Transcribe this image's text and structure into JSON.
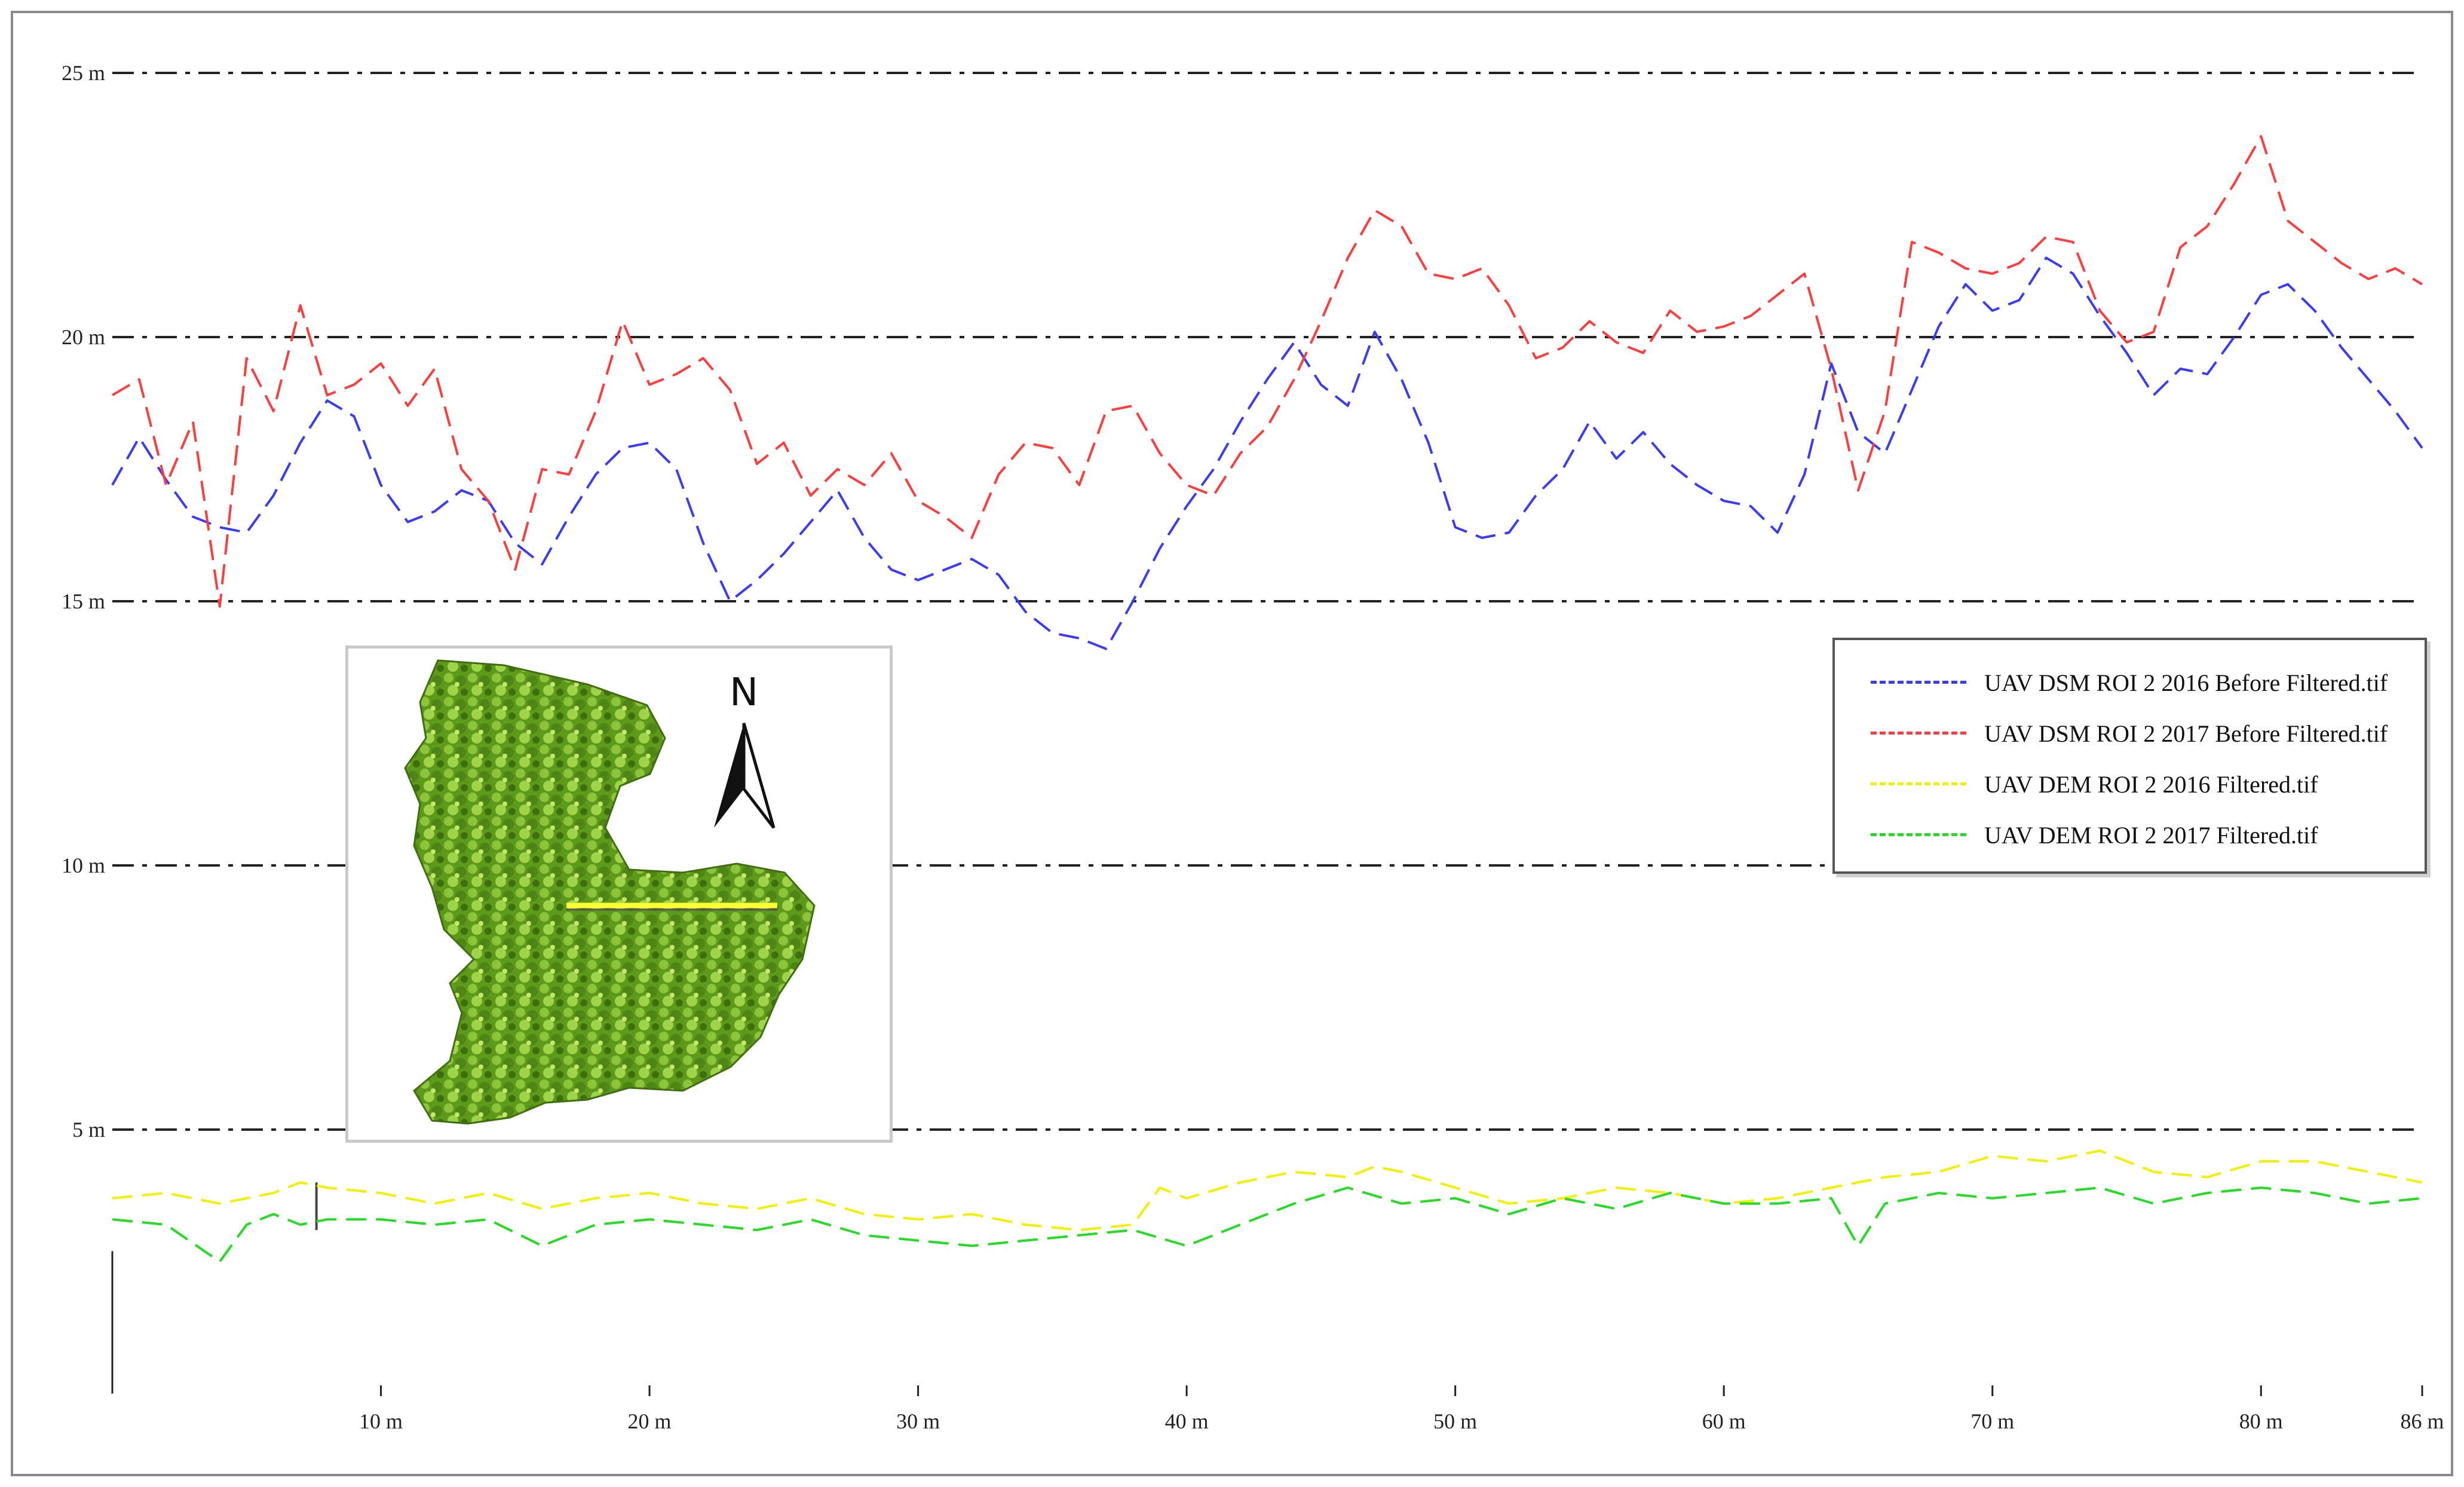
{
  "chart_data": {
    "type": "line",
    "title": "",
    "xlabel": "",
    "ylabel": "",
    "xlim": [
      0,
      86
    ],
    "ylim": [
      0,
      25
    ],
    "x_ticks": [
      "10 m",
      "20 m",
      "30 m",
      "40 m",
      "50 m",
      "60 m",
      "70 m",
      "80 m",
      "86 m"
    ],
    "y_ticks": [
      "5 m",
      "10 m",
      "15 m",
      "20 m",
      "25 m"
    ],
    "grid": "horizontal dash-dot",
    "legend_position": "right-middle",
    "series": [
      {
        "name": "UAV DSM ROI 2 2016 Before Filtered.tif",
        "color": "#3a3aff",
        "style": "dashed",
        "x": [
          0,
          1,
          2,
          3,
          4,
          5,
          6,
          7,
          8,
          9,
          10,
          11,
          12,
          13,
          14,
          15,
          16,
          17,
          18,
          19,
          20,
          21,
          22,
          23,
          24,
          25,
          26,
          27,
          28,
          29,
          30,
          31,
          32,
          33,
          34,
          35,
          36,
          37,
          38,
          39,
          40,
          41,
          42,
          43,
          44,
          45,
          46,
          47,
          48,
          49,
          50,
          51,
          52,
          53,
          54,
          55,
          56,
          57,
          58,
          59,
          60,
          61,
          62,
          63,
          64,
          65,
          66,
          67,
          68,
          69,
          70,
          71,
          72,
          73,
          74,
          75,
          76,
          77,
          78,
          79,
          80,
          81,
          82,
          83,
          84,
          85,
          86
        ],
        "values": [
          17.2,
          18.1,
          17.3,
          16.6,
          16.4,
          16.3,
          17.0,
          18.0,
          18.8,
          18.5,
          17.2,
          16.5,
          16.7,
          17.1,
          16.9,
          16.1,
          15.7,
          16.6,
          17.4,
          17.9,
          18.0,
          17.5,
          16.1,
          15.0,
          15.4,
          15.9,
          16.5,
          17.1,
          16.2,
          15.6,
          15.4,
          15.6,
          15.8,
          15.5,
          14.8,
          14.4,
          14.3,
          14.1,
          15.0,
          16.0,
          16.8,
          17.5,
          18.4,
          19.2,
          19.9,
          19.1,
          18.7,
          20.1,
          19.2,
          18.0,
          16.4,
          16.2,
          16.3,
          17.0,
          17.5,
          18.4,
          17.7,
          18.2,
          17.6,
          17.2,
          16.9,
          16.8,
          16.3,
          17.4,
          19.5,
          18.2,
          17.8,
          19.0,
          20.2,
          21.0,
          20.5,
          20.7,
          21.5,
          21.2,
          20.4,
          19.7,
          18.9,
          19.4,
          19.3,
          20.0,
          20.8,
          21.0,
          20.5,
          19.8,
          19.2,
          18.6,
          17.9
        ]
      },
      {
        "name": "UAV DSM ROI 2 2017 Before Filtered.tif",
        "color": "#ff3b3b",
        "style": "dashed",
        "x": [
          0,
          1,
          2,
          3,
          4,
          5,
          6,
          7,
          8,
          9,
          10,
          11,
          12,
          13,
          14,
          15,
          16,
          17,
          18,
          19,
          20,
          21,
          22,
          23,
          24,
          25,
          26,
          27,
          28,
          29,
          30,
          31,
          32,
          33,
          34,
          35,
          36,
          37,
          38,
          39,
          40,
          41,
          42,
          43,
          44,
          45,
          46,
          47,
          48,
          49,
          50,
          51,
          52,
          53,
          54,
          55,
          56,
          57,
          58,
          59,
          60,
          61,
          62,
          63,
          64,
          65,
          66,
          67,
          68,
          69,
          70,
          71,
          72,
          73,
          74,
          75,
          76,
          77,
          78,
          79,
          80,
          81,
          82,
          83,
          84,
          85,
          86
        ],
        "values": [
          18.9,
          19.2,
          17.2,
          18.4,
          14.9,
          19.6,
          18.6,
          20.6,
          18.9,
          19.1,
          19.5,
          18.7,
          19.4,
          17.5,
          16.9,
          15.6,
          17.5,
          17.4,
          18.6,
          20.3,
          19.1,
          19.3,
          19.6,
          19.0,
          17.6,
          18.0,
          17.0,
          17.5,
          17.2,
          17.8,
          16.9,
          16.6,
          16.2,
          17.4,
          18.0,
          17.9,
          17.2,
          18.6,
          18.7,
          17.8,
          17.2,
          17.0,
          17.8,
          18.3,
          19.2,
          20.3,
          21.5,
          22.4,
          22.1,
          21.2,
          21.1,
          21.3,
          20.6,
          19.6,
          19.8,
          20.3,
          19.9,
          19.7,
          20.5,
          20.1,
          20.2,
          20.4,
          20.8,
          21.2,
          19.4,
          17.1,
          18.6,
          21.8,
          21.6,
          21.3,
          21.2,
          21.4,
          21.9,
          21.8,
          20.5,
          19.9,
          20.1,
          21.7,
          22.1,
          22.9,
          23.8,
          22.2,
          21.8,
          21.4,
          21.1,
          21.3,
          21.0
        ]
      },
      {
        "name": "UAV DEM ROI 2 2016 Filtered.tif",
        "color": "#f2f200",
        "style": "dashed",
        "x": [
          0,
          2,
          4,
          6,
          7,
          8,
          10,
          12,
          14,
          16,
          18,
          20,
          22,
          24,
          26,
          28,
          30,
          32,
          34,
          36,
          38,
          39,
          40,
          42,
          44,
          46,
          47,
          48,
          50,
          52,
          54,
          56,
          58,
          60,
          62,
          64,
          66,
          68,
          70,
          72,
          74,
          76,
          78,
          80,
          82,
          84,
          86
        ],
        "values": [
          3.7,
          3.8,
          3.6,
          3.8,
          4.0,
          3.9,
          3.8,
          3.6,
          3.8,
          3.5,
          3.7,
          3.8,
          3.6,
          3.5,
          3.7,
          3.4,
          3.3,
          3.4,
          3.2,
          3.1,
          3.2,
          3.9,
          3.7,
          4.0,
          4.2,
          4.1,
          4.3,
          4.2,
          3.9,
          3.6,
          3.7,
          3.9,
          3.8,
          3.6,
          3.7,
          3.9,
          4.1,
          4.2,
          4.5,
          4.4,
          4.6,
          4.2,
          4.1,
          4.4,
          4.4,
          4.2,
          4.0
        ]
      },
      {
        "name": "UAV DEM ROI 2 2017 Filtered.tif",
        "color": "#22dd22",
        "style": "dashed",
        "x": [
          0,
          2,
          4,
          5,
          6,
          7,
          8,
          10,
          12,
          14,
          16,
          18,
          20,
          22,
          24,
          26,
          28,
          30,
          32,
          34,
          36,
          38,
          40,
          42,
          44,
          46,
          48,
          50,
          52,
          54,
          56,
          58,
          60,
          62,
          64,
          65,
          66,
          68,
          70,
          72,
          74,
          76,
          78,
          80,
          82,
          84,
          86
        ],
        "values": [
          3.3,
          3.2,
          2.5,
          3.2,
          3.4,
          3.2,
          3.3,
          3.3,
          3.2,
          3.3,
          2.8,
          3.2,
          3.3,
          3.2,
          3.1,
          3.3,
          3.0,
          2.9,
          2.8,
          2.9,
          3.0,
          3.1,
          2.8,
          3.2,
          3.6,
          3.9,
          3.6,
          3.7,
          3.4,
          3.7,
          3.5,
          3.8,
          3.6,
          3.6,
          3.7,
          2.8,
          3.6,
          3.8,
          3.7,
          3.8,
          3.9,
          3.6,
          3.8,
          3.9,
          3.8,
          3.6,
          3.7
        ]
      }
    ]
  },
  "inset": {
    "north_label": "N",
    "canopy_color": "#6aa51f",
    "transect_color": "#ffff33"
  }
}
